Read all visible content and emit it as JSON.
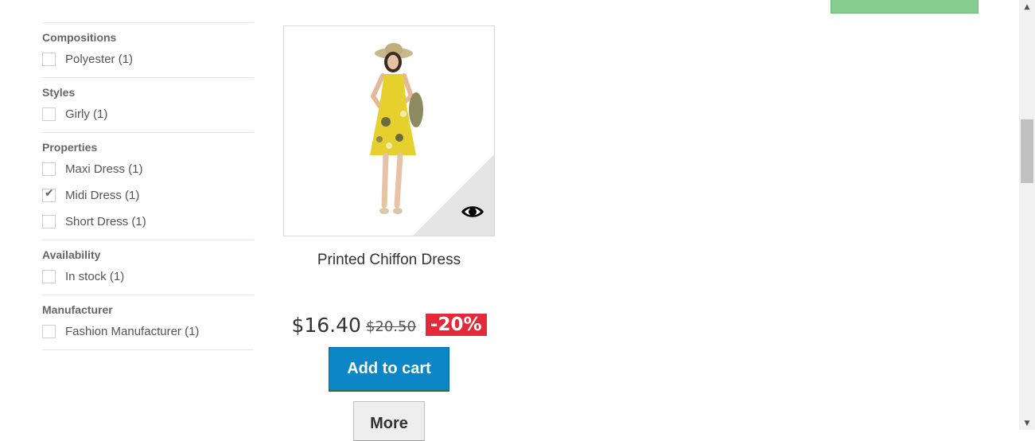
{
  "filters": [
    {
      "title": "Compositions",
      "items": [
        {
          "label": "Polyester (1)",
          "checked": false
        }
      ]
    },
    {
      "title": "Styles",
      "items": [
        {
          "label": "Girly (1)",
          "checked": false
        }
      ]
    },
    {
      "title": "Properties",
      "items": [
        {
          "label": "Maxi Dress (1)",
          "checked": false
        },
        {
          "label": "Midi Dress (1)",
          "checked": true
        },
        {
          "label": "Short Dress (1)",
          "checked": false
        }
      ]
    },
    {
      "title": "Availability",
      "items": [
        {
          "label": "In stock (1)",
          "checked": false
        }
      ]
    },
    {
      "title": "Manufacturer",
      "items": [
        {
          "label": "Fashion Manufacturer (1)",
          "checked": false
        }
      ]
    }
  ],
  "product": {
    "name": "Printed Chiffon Dress",
    "price": "$16.40",
    "old_price": "$20.50",
    "discount": "-20%",
    "add_to_cart_label": "Add to cart",
    "more_label": "More",
    "quick_view_icon": "eye-icon",
    "image_icon": "dress-photo"
  },
  "colors": {
    "add_to_cart": "#0d86c6",
    "discount": "#e4293b",
    "top_button": "#86cc8e"
  },
  "scrollbar": {
    "up_icon": "arrow-up-icon",
    "down_icon": "arrow-down-icon"
  }
}
